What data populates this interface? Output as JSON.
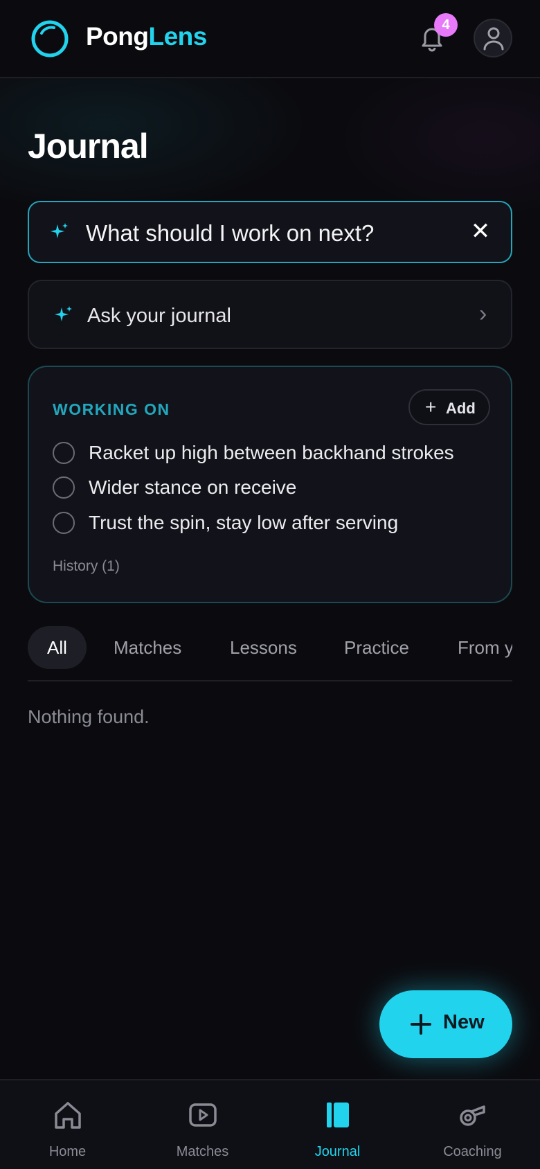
{
  "header": {
    "brand_part1": "Pong",
    "brand_part2": "Lens",
    "notification_count": "4"
  },
  "page": {
    "title": "Journal"
  },
  "query": {
    "text": "What should I work on next?",
    "close_label": "✕"
  },
  "ask": {
    "label": "Ask your journal",
    "chevron": "›"
  },
  "working_on": {
    "label": "WORKING ON",
    "add_label": "Add",
    "items": [
      {
        "text": "Racket up high between backhand strokes"
      },
      {
        "text": "Wider stance on receive"
      },
      {
        "text": "Trust the spin, stay low after serving"
      }
    ],
    "history_label": "History (1)"
  },
  "filters": {
    "tabs": [
      {
        "label": "All",
        "active": true
      },
      {
        "label": "Matches"
      },
      {
        "label": "Lessons"
      },
      {
        "label": "Practice"
      },
      {
        "label": "From y"
      }
    ]
  },
  "empty_state": "Nothing found.",
  "fab": {
    "label": "New"
  },
  "nav": {
    "items": [
      {
        "label": "Home",
        "icon": "home-icon"
      },
      {
        "label": "Matches",
        "icon": "play-icon"
      },
      {
        "label": "Journal",
        "icon": "journal-icon",
        "active": true
      },
      {
        "label": "Coaching",
        "icon": "whistle-icon"
      }
    ]
  },
  "colors": {
    "accent": "#22d3ee",
    "badge": "#e879f9",
    "background": "#0b0b0f"
  }
}
